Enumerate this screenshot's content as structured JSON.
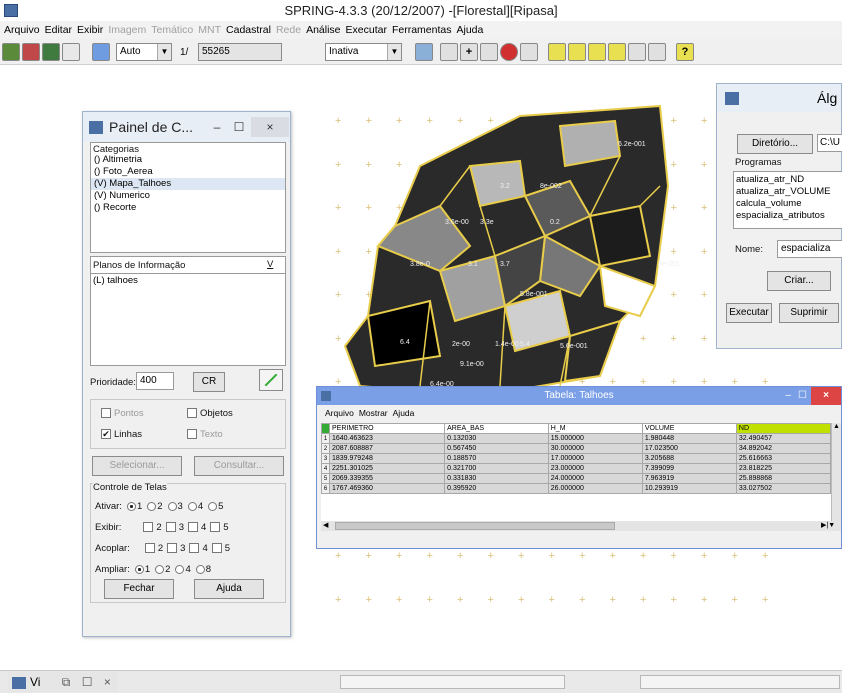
{
  "title": "SPRING-4.3.3 (20/12/2007) -[Florestal][Ripasa]",
  "menu": [
    {
      "label": "Arquivo",
      "enabled": true
    },
    {
      "label": "Editar",
      "enabled": true
    },
    {
      "label": "Exibir",
      "enabled": true
    },
    {
      "label": "Imagem",
      "enabled": false
    },
    {
      "label": "Temático",
      "enabled": false
    },
    {
      "label": "MNT",
      "enabled": false
    },
    {
      "label": "Cadastral",
      "enabled": true
    },
    {
      "label": "Rede",
      "enabled": false
    },
    {
      "label": "Análise",
      "enabled": true
    },
    {
      "label": "Executar",
      "enabled": true
    },
    {
      "label": "Ferramentas",
      "enabled": true
    },
    {
      "label": "Ajuda",
      "enabled": true
    }
  ],
  "toolbar": {
    "zoom_mode": "Auto",
    "scale_prefix": "1/",
    "scale_value": "55265",
    "cursor_mode": "Inativa"
  },
  "map_labels": [
    "6.2e-001",
    "3.2",
    "8e-002",
    "3.6e-00",
    "3.3e",
    "0.2",
    "3.8e-0",
    "3.1",
    "3.7",
    "8e-001",
    "5.8e-001",
    "6.4",
    "2e-00",
    "1.4e-00",
    "5.4",
    "9.1e-00",
    "6.4e-00",
    "5.6e-001"
  ],
  "panel": {
    "title": "Painel de C...",
    "categories_label": "Categorias",
    "categories": [
      "() Altimetria",
      "() Foto_Aerea",
      "(V) Mapa_Talhoes",
      "(V) Numerico",
      "() Recorte"
    ],
    "planes_label": "Planos de Informação",
    "planes_selector": "V",
    "planes": [
      "(L) talhoes"
    ],
    "priority_label": "Prioridade:",
    "priority_value": "400",
    "cr_label": "CR",
    "opt_pontos": "Pontos",
    "opt_objetos": "Objetos",
    "opt_linhas": "Linhas",
    "opt_texto": "Texto",
    "btn_selecionar": "Selecionar...",
    "btn_consultar": "Consultar...",
    "controle_label": "Controle de Telas",
    "ativar_label": "Ativar:",
    "exibir_label": "Exibir:",
    "acoplar_label": "Acoplar:",
    "ampliar_label": "Ampliar:",
    "ativar_opts": [
      "1",
      "2",
      "3",
      "4",
      "5"
    ],
    "num_opts": [
      "2",
      "3",
      "4",
      "5"
    ],
    "ampliar_opts": [
      "1",
      "2",
      "4",
      "8"
    ],
    "btn_fechar": "Fechar",
    "btn_ajuda": "Ajuda"
  },
  "algebra": {
    "title": "Álg",
    "btn_diretorio": "Diretório...",
    "path": "C:\\U",
    "programas_label": "Programas",
    "programs": [
      "atualiza_atr_ND",
      "atualiza_atr_VOLUME",
      "calcula_volume",
      "espacializa_atributos"
    ],
    "nome_label": "Nome:",
    "nome_value": "espacializa",
    "btn_criar": "Criar...",
    "btn_executar": "Executar",
    "btn_suprimir": "Suprimir"
  },
  "table_window": {
    "title": "Tabela: Talhoes",
    "menu": [
      "Arquivo",
      "Mostrar",
      "Ajuda"
    ],
    "columns": [
      "PERIMETRO",
      "AREA_BAS",
      "H_M",
      "VOLUME",
      "ND"
    ],
    "rows": [
      [
        "1",
        "1640.463623",
        "0.132030",
        "15.000000",
        "1.980448",
        "32.490457"
      ],
      [
        "2",
        "2087.608887",
        "0.567450",
        "30.000000",
        "17.023500",
        "34.892042"
      ],
      [
        "3",
        "1839.979248",
        "0.188570",
        "17.000000",
        "3.205688",
        "25.616663"
      ],
      [
        "4",
        "2251.301025",
        "0.321700",
        "23.000000",
        "7.399099",
        "23.818225"
      ],
      [
        "5",
        "2069.339355",
        "0.331830",
        "24.000000",
        "7.963919",
        "25.898868"
      ],
      [
        "6",
        "1767.469360",
        "0.395920",
        "26.000000",
        "10.293919",
        "33.027502"
      ]
    ]
  },
  "taskbar": {
    "label": "Vi"
  },
  "colors": {
    "highlight": "#c0e000",
    "table_title": "#7b9fe6",
    "map_outline": "#e8cc4a"
  }
}
